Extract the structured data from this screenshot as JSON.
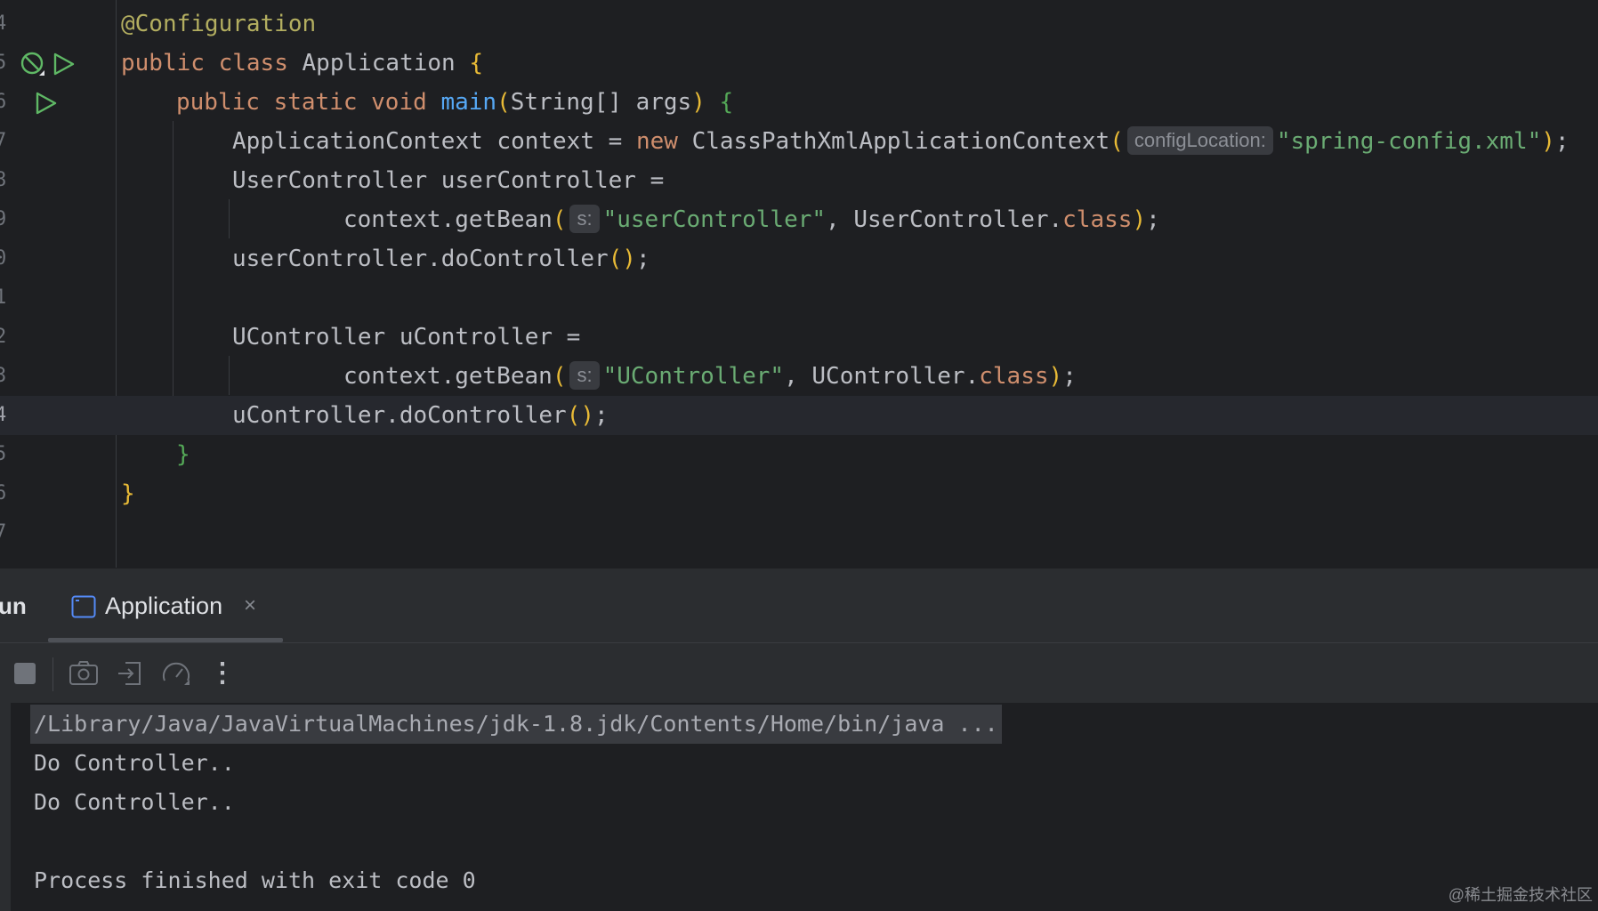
{
  "editor": {
    "lines": [
      {
        "number": "4"
      },
      {
        "number": "5"
      },
      {
        "number": "6"
      },
      {
        "number": "7"
      },
      {
        "number": "8"
      },
      {
        "number": "9"
      },
      {
        "number": "0"
      },
      {
        "number": "1"
      },
      {
        "number": "2"
      },
      {
        "number": "3"
      },
      {
        "number": "4"
      },
      {
        "number": "5"
      },
      {
        "number": "6"
      },
      {
        "number": "7"
      }
    ],
    "code": {
      "l4": {
        "annotation": "@Configuration"
      },
      "l5": {
        "kw1": "public",
        "kw2": "class",
        "name": "Application",
        "brace": "{"
      },
      "l6": {
        "kw1": "public",
        "kw2": "static",
        "kw3": "void",
        "method": "main",
        "paren_open": "(",
        "params": "String[] args",
        "paren_close": ")",
        "brace": "{"
      },
      "l7": {
        "text1": "ApplicationContext context = ",
        "kw": "new",
        "text2": " ClassPathXmlApplicationContext",
        "paren_open": "(",
        "hint": "configLocation:",
        "str": "\"spring-config.xml\"",
        "paren_close": ")",
        "end": ";"
      },
      "l8": {
        "text": "UserController userController ="
      },
      "l9": {
        "text1": "context.getBean",
        "paren_open": "(",
        "hint": "s:",
        "str": "\"userController\"",
        "text2": ", UserController.",
        "kw": "class",
        "paren_close": ")",
        "end": ";"
      },
      "l10": {
        "text": "userController.doController",
        "parens": "()",
        "end": ";"
      },
      "l12": {
        "text": "UController uController ="
      },
      "l13": {
        "text1": "context.getBean",
        "paren_open": "(",
        "hint": "s:",
        "str": "\"UController\"",
        "text2": ", UController.",
        "kw": "class",
        "paren_close": ")",
        "end": ";"
      },
      "l14": {
        "text": "uController.doController",
        "parens": "()",
        "end": ";"
      },
      "l15": {
        "brace": "}"
      },
      "l16": {
        "brace": "}"
      }
    }
  },
  "run_panel": {
    "label": "un",
    "tab_label": "Application",
    "tab_close": "×"
  },
  "toolbar": {
    "buttons": [
      "stop-icon",
      "camera-icon",
      "login-icon",
      "speed-gauge-icon",
      "more-vertical-icon"
    ],
    "more_label": "⋮"
  },
  "console": {
    "lines": [
      "/Library/Java/JavaVirtualMachines/jdk-1.8.jdk/Contents/Home/bin/java ...",
      "Do Controller..",
      "Do Controller..",
      "",
      "Process finished with exit code 0"
    ]
  },
  "watermark": "@稀土掘金技术社区",
  "colors": {
    "background": "#1e1f22",
    "keyword": "#cf8e6d",
    "string": "#6aab73",
    "method": "#56a8f5",
    "annotation": "#b3ae60",
    "run_green": "#5fb865"
  }
}
